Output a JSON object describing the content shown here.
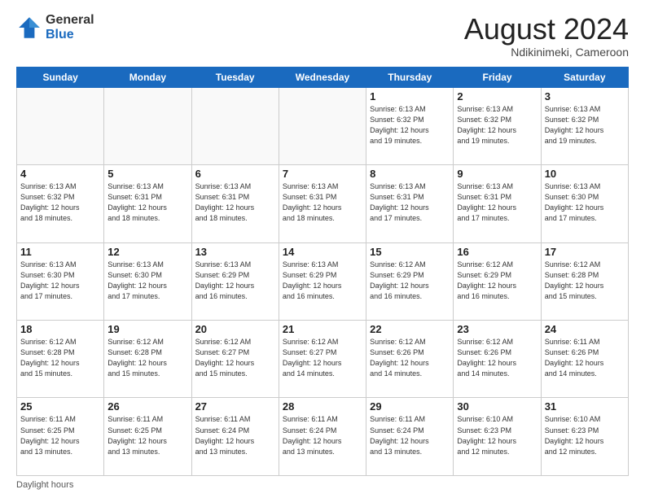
{
  "logo": {
    "general": "General",
    "blue": "Blue"
  },
  "title": "August 2024",
  "location": "Ndikinimeki, Cameroon",
  "days_header": [
    "Sunday",
    "Monday",
    "Tuesday",
    "Wednesday",
    "Thursday",
    "Friday",
    "Saturday"
  ],
  "weeks": [
    [
      {
        "day": "",
        "info": ""
      },
      {
        "day": "",
        "info": ""
      },
      {
        "day": "",
        "info": ""
      },
      {
        "day": "",
        "info": ""
      },
      {
        "day": "1",
        "info": "Sunrise: 6:13 AM\nSunset: 6:32 PM\nDaylight: 12 hours\nand 19 minutes."
      },
      {
        "day": "2",
        "info": "Sunrise: 6:13 AM\nSunset: 6:32 PM\nDaylight: 12 hours\nand 19 minutes."
      },
      {
        "day": "3",
        "info": "Sunrise: 6:13 AM\nSunset: 6:32 PM\nDaylight: 12 hours\nand 19 minutes."
      }
    ],
    [
      {
        "day": "4",
        "info": "Sunrise: 6:13 AM\nSunset: 6:32 PM\nDaylight: 12 hours\nand 18 minutes."
      },
      {
        "day": "5",
        "info": "Sunrise: 6:13 AM\nSunset: 6:31 PM\nDaylight: 12 hours\nand 18 minutes."
      },
      {
        "day": "6",
        "info": "Sunrise: 6:13 AM\nSunset: 6:31 PM\nDaylight: 12 hours\nand 18 minutes."
      },
      {
        "day": "7",
        "info": "Sunrise: 6:13 AM\nSunset: 6:31 PM\nDaylight: 12 hours\nand 18 minutes."
      },
      {
        "day": "8",
        "info": "Sunrise: 6:13 AM\nSunset: 6:31 PM\nDaylight: 12 hours\nand 17 minutes."
      },
      {
        "day": "9",
        "info": "Sunrise: 6:13 AM\nSunset: 6:31 PM\nDaylight: 12 hours\nand 17 minutes."
      },
      {
        "day": "10",
        "info": "Sunrise: 6:13 AM\nSunset: 6:30 PM\nDaylight: 12 hours\nand 17 minutes."
      }
    ],
    [
      {
        "day": "11",
        "info": "Sunrise: 6:13 AM\nSunset: 6:30 PM\nDaylight: 12 hours\nand 17 minutes."
      },
      {
        "day": "12",
        "info": "Sunrise: 6:13 AM\nSunset: 6:30 PM\nDaylight: 12 hours\nand 17 minutes."
      },
      {
        "day": "13",
        "info": "Sunrise: 6:13 AM\nSunset: 6:29 PM\nDaylight: 12 hours\nand 16 minutes."
      },
      {
        "day": "14",
        "info": "Sunrise: 6:13 AM\nSunset: 6:29 PM\nDaylight: 12 hours\nand 16 minutes."
      },
      {
        "day": "15",
        "info": "Sunrise: 6:12 AM\nSunset: 6:29 PM\nDaylight: 12 hours\nand 16 minutes."
      },
      {
        "day": "16",
        "info": "Sunrise: 6:12 AM\nSunset: 6:29 PM\nDaylight: 12 hours\nand 16 minutes."
      },
      {
        "day": "17",
        "info": "Sunrise: 6:12 AM\nSunset: 6:28 PM\nDaylight: 12 hours\nand 15 minutes."
      }
    ],
    [
      {
        "day": "18",
        "info": "Sunrise: 6:12 AM\nSunset: 6:28 PM\nDaylight: 12 hours\nand 15 minutes."
      },
      {
        "day": "19",
        "info": "Sunrise: 6:12 AM\nSunset: 6:28 PM\nDaylight: 12 hours\nand 15 minutes."
      },
      {
        "day": "20",
        "info": "Sunrise: 6:12 AM\nSunset: 6:27 PM\nDaylight: 12 hours\nand 15 minutes."
      },
      {
        "day": "21",
        "info": "Sunrise: 6:12 AM\nSunset: 6:27 PM\nDaylight: 12 hours\nand 14 minutes."
      },
      {
        "day": "22",
        "info": "Sunrise: 6:12 AM\nSunset: 6:26 PM\nDaylight: 12 hours\nand 14 minutes."
      },
      {
        "day": "23",
        "info": "Sunrise: 6:12 AM\nSunset: 6:26 PM\nDaylight: 12 hours\nand 14 minutes."
      },
      {
        "day": "24",
        "info": "Sunrise: 6:11 AM\nSunset: 6:26 PM\nDaylight: 12 hours\nand 14 minutes."
      }
    ],
    [
      {
        "day": "25",
        "info": "Sunrise: 6:11 AM\nSunset: 6:25 PM\nDaylight: 12 hours\nand 13 minutes."
      },
      {
        "day": "26",
        "info": "Sunrise: 6:11 AM\nSunset: 6:25 PM\nDaylight: 12 hours\nand 13 minutes."
      },
      {
        "day": "27",
        "info": "Sunrise: 6:11 AM\nSunset: 6:24 PM\nDaylight: 12 hours\nand 13 minutes."
      },
      {
        "day": "28",
        "info": "Sunrise: 6:11 AM\nSunset: 6:24 PM\nDaylight: 12 hours\nand 13 minutes."
      },
      {
        "day": "29",
        "info": "Sunrise: 6:11 AM\nSunset: 6:24 PM\nDaylight: 12 hours\nand 13 minutes."
      },
      {
        "day": "30",
        "info": "Sunrise: 6:10 AM\nSunset: 6:23 PM\nDaylight: 12 hours\nand 12 minutes."
      },
      {
        "day": "31",
        "info": "Sunrise: 6:10 AM\nSunset: 6:23 PM\nDaylight: 12 hours\nand 12 minutes."
      }
    ]
  ],
  "footer": "Daylight hours"
}
